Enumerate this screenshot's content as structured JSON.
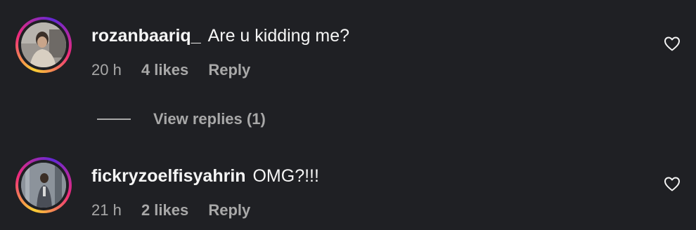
{
  "comments": [
    {
      "username": "rozanbaariq_",
      "text": "Are u kidding me?",
      "time": "20 h",
      "likes": "4 likes",
      "reply": "Reply"
    },
    {
      "username": "fickryzoelfisyahrin",
      "text": "OMG?!!!",
      "time": "21 h",
      "likes": "2 likes",
      "reply": "Reply"
    }
  ],
  "view_replies": "View replies (1)",
  "colors": {
    "background": "#1f2024",
    "primary_text": "#f5f5f5",
    "secondary_text": "#a8a8a8"
  },
  "icons": [
    "avatar",
    "heart-icon"
  ]
}
